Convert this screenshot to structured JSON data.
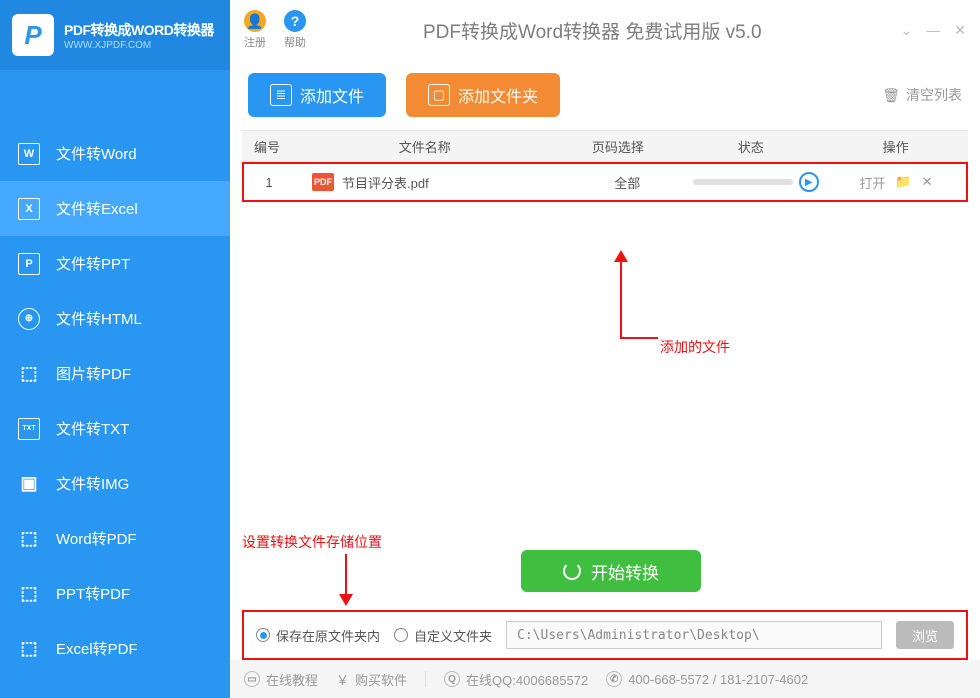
{
  "brand": {
    "title": "PDF转换成WORD转换器",
    "sub": "WWW.XJPDF.COM"
  },
  "titlebar": {
    "register": "注册",
    "help": "帮助",
    "title": "PDF转换成Word转换器 免费试用版 v5.0"
  },
  "sidebar": {
    "items": [
      {
        "label": "文件转Word",
        "icon": "W"
      },
      {
        "label": "文件转Excel",
        "icon": "X"
      },
      {
        "label": "文件转PPT",
        "icon": "P"
      },
      {
        "label": "文件转HTML",
        "icon": "⊕"
      },
      {
        "label": "图片转PDF",
        "icon": "⬚"
      },
      {
        "label": "文件转TXT",
        "icon": "TXT"
      },
      {
        "label": "文件转IMG",
        "icon": "▣"
      },
      {
        "label": "Word转PDF",
        "icon": "⬚"
      },
      {
        "label": "PPT转PDF",
        "icon": "⬚"
      },
      {
        "label": "Excel转PDF",
        "icon": "⬚"
      }
    ]
  },
  "toolbar": {
    "add_file": "添加文件",
    "add_folder": "添加文件夹",
    "clear": "清空列表"
  },
  "table": {
    "headers": {
      "idx": "编号",
      "name": "文件名称",
      "page": "页码选择",
      "state": "状态",
      "op": "操作"
    },
    "rows": [
      {
        "idx": "1",
        "name": "节目评分表.pdf",
        "page": "全部",
        "open": "打开"
      }
    ]
  },
  "annotations": {
    "file_added": "添加的文件",
    "save_location": "设置转换文件存储位置"
  },
  "convert": {
    "label": "开始转换"
  },
  "save": {
    "opt_same": "保存在原文件夹内",
    "opt_custom": "自定义文件夹",
    "path": "C:\\Users\\Administrator\\Desktop\\",
    "browse": "浏览"
  },
  "status": {
    "tutorial": "在线教程",
    "buy": "购买软件",
    "qq": "在线QQ:4006685572",
    "phone": "400-668-5572 / 181-2107-4602"
  }
}
